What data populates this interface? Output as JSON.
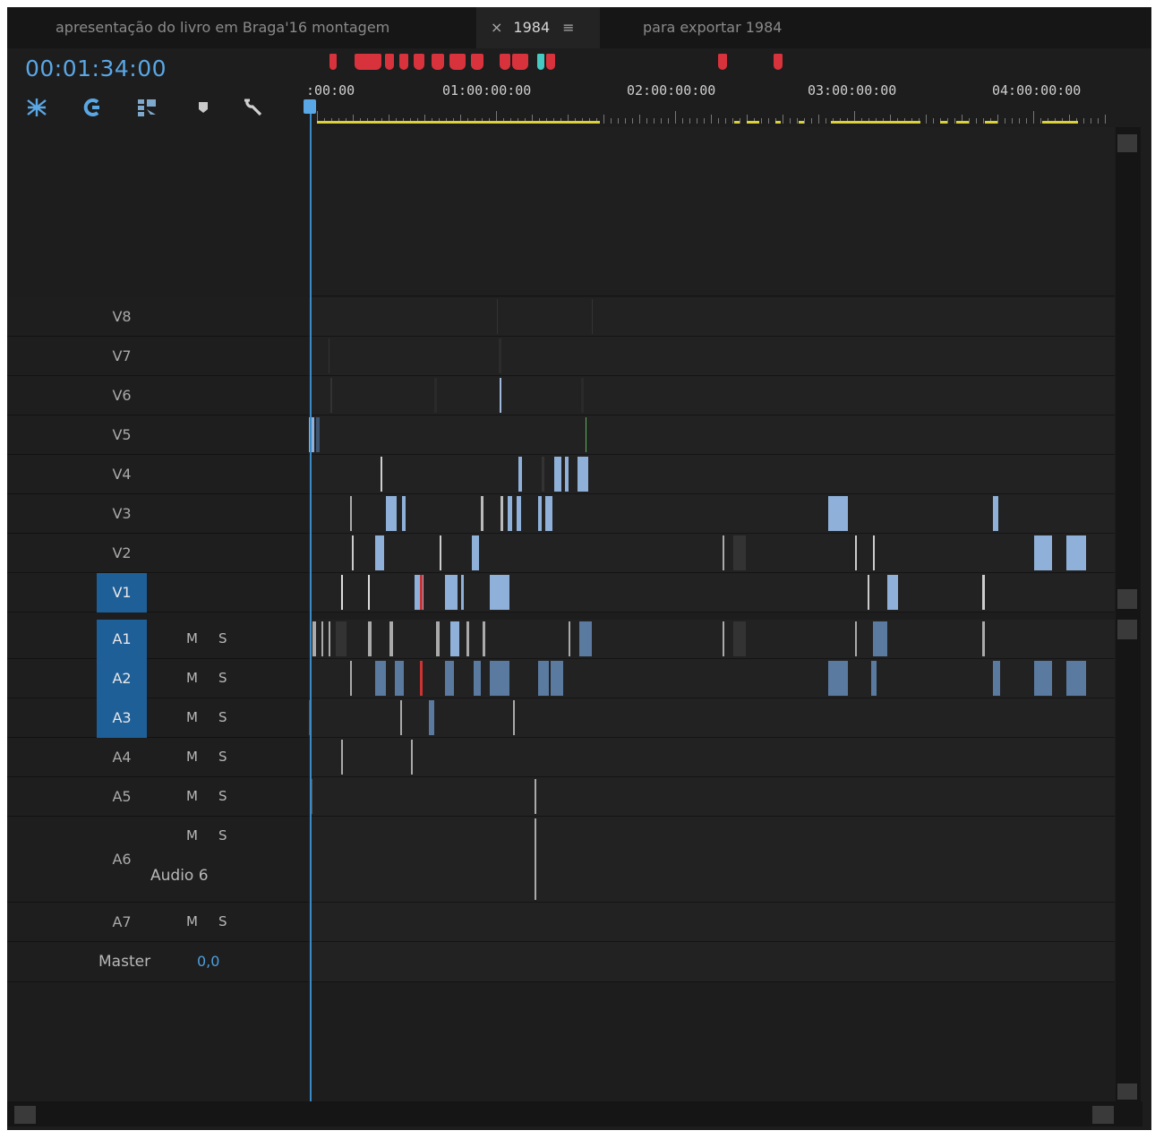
{
  "tabs": [
    {
      "label": "apresentação do livro em Braga'16 montagem",
      "active": false
    },
    {
      "label": "1984",
      "active": true,
      "close": "×",
      "menu": "≡"
    },
    {
      "label": "para exportar 1984",
      "active": false
    }
  ],
  "timecode": "00:01:34:00",
  "ruler": {
    "labels": [
      ":00:00",
      "01:00:00:00",
      "02:00:00:00",
      "03:00:00:00",
      "04:00:00:00"
    ]
  },
  "toolbar": {
    "icons": [
      "snap-icon",
      "linked-selection-icon",
      "insert-overwrite-icon",
      "add-marker-icon",
      "timeline-settings-icon"
    ]
  },
  "video_tracks": [
    {
      "name": "V8",
      "targeted": false
    },
    {
      "name": "V7",
      "targeted": false
    },
    {
      "name": "V6",
      "targeted": false
    },
    {
      "name": "V5",
      "targeted": false
    },
    {
      "name": "V4",
      "targeted": false
    },
    {
      "name": "V3",
      "targeted": false
    },
    {
      "name": "V2",
      "targeted": false
    },
    {
      "name": "V1",
      "targeted": true
    }
  ],
  "audio_tracks": [
    {
      "name": "A1",
      "targeted": true,
      "mute": "M",
      "solo": "S",
      "label": ""
    },
    {
      "name": "A2",
      "targeted": true,
      "mute": "M",
      "solo": "S",
      "label": ""
    },
    {
      "name": "A3",
      "targeted": true,
      "mute": "M",
      "solo": "S",
      "label": ""
    },
    {
      "name": "A4",
      "targeted": false,
      "mute": "M",
      "solo": "S",
      "label": ""
    },
    {
      "name": "A5",
      "targeted": false,
      "mute": "M",
      "solo": "S",
      "label": ""
    },
    {
      "name": "A6",
      "targeted": false,
      "mute": "M",
      "solo": "S",
      "label": "Audio 6"
    },
    {
      "name": "A7",
      "targeted": false,
      "mute": "M",
      "solo": "S",
      "label": ""
    }
  ],
  "master": {
    "label": "Master",
    "volume": "0,0"
  },
  "colors": {
    "accent": "#5aa7e6",
    "target": "#1f5f98",
    "marker": "#d8333c",
    "clip_video": "#7fa6d8",
    "clip_audio": "#3f5a7e"
  }
}
